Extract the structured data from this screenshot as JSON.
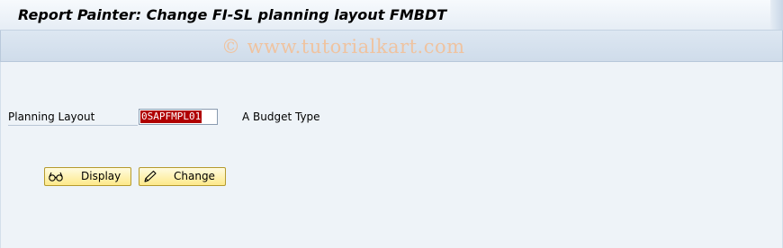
{
  "window": {
    "title": "Report Painter: Change FI-SL planning layout FMBDT"
  },
  "watermark": "© www.tutorialkart.com",
  "form": {
    "planning_layout_label": "Planning Layout",
    "planning_layout_value": "0SAPFMPL01",
    "planning_layout_description": "A Budget Type"
  },
  "buttons": {
    "display_label": "Display",
    "display_icon": "glasses-icon",
    "change_label": "Change",
    "change_icon": "pencil-icon"
  }
}
